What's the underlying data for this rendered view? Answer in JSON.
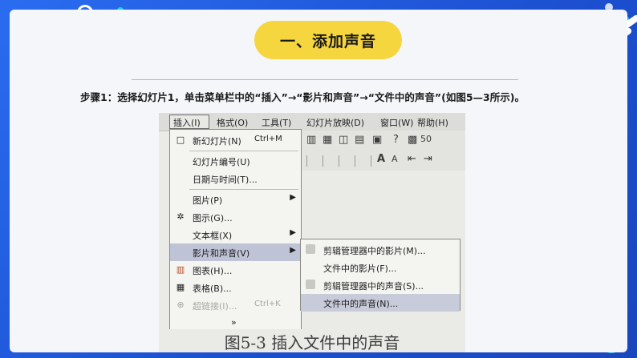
{
  "slide": {
    "title": "一、添加声音",
    "step_text": "步骤1：选择幻灯片1，单击菜单栏中的“插入”→“影片和声音”→“文件中的声音”(如图5—3所示)。",
    "colors": {
      "background": "#1d5bd8",
      "pill": "#f6d63e",
      "card": "#f5f6fa",
      "accent": "#22c8f0"
    }
  },
  "screenshot": {
    "menubar": [
      {
        "label": "插入(I)",
        "active": true
      },
      {
        "label": "格式(O)"
      },
      {
        "label": "工具(T)"
      },
      {
        "label": "幻灯片放映(D)"
      },
      {
        "label": "窗口(W)"
      },
      {
        "label": "帮助(H)"
      }
    ],
    "toolbar_zoom": "50",
    "insert_menu": [
      {
        "label": "新幻灯片(N)",
        "shortcut": "Ctrl+M",
        "icon": "new-slide-icon"
      },
      {
        "label": "幻灯片编号(U)"
      },
      {
        "label": "日期与时间(T)..."
      },
      {
        "label": "图片(P)",
        "submenu": true
      },
      {
        "label": "图示(G)...",
        "icon": "diagram-icon"
      },
      {
        "label": "文本框(X)",
        "submenu": true
      },
      {
        "label": "影片和声音(V)",
        "submenu": true,
        "highlighted": true
      },
      {
        "label": "图表(H)...",
        "icon": "chart-icon"
      },
      {
        "label": "表格(B)...",
        "icon": "table-icon"
      },
      {
        "label": "超链接(I)...",
        "shortcut": "Ctrl+K",
        "disabled": true,
        "icon": "hyperlink-icon"
      },
      {
        "label": "»",
        "icon": "expand-icon"
      }
    ],
    "movies_sounds_submenu": [
      {
        "label": "剪辑管理器中的影片(M)..."
      },
      {
        "label": "文件中的影片(F)..."
      },
      {
        "label": "剪辑管理器中的声音(S)..."
      },
      {
        "label": "文件中的声音(N)...",
        "highlighted": true
      }
    ],
    "caption": "图5-3   插入文件中的声音"
  }
}
